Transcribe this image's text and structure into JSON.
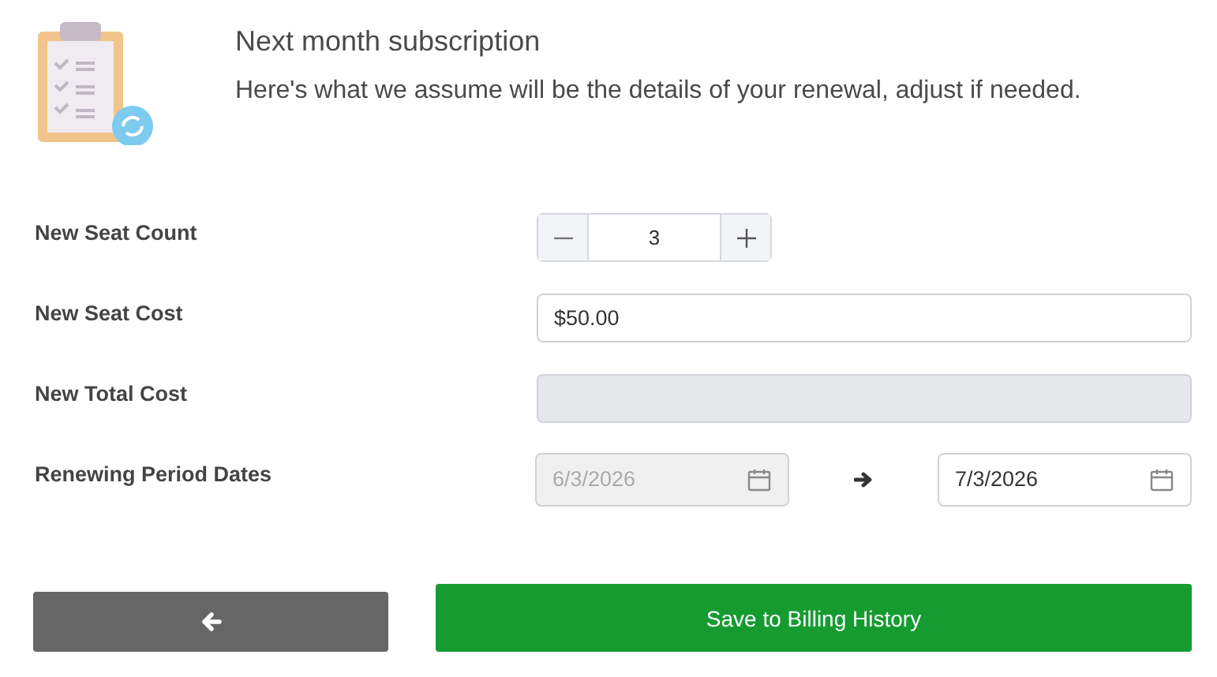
{
  "header": {
    "title": "Next month subscription",
    "description": "Here's what we assume will be the details of your renewal, adjust if needed."
  },
  "rows": [
    {
      "kind": "stepper",
      "label": "New Seat Count",
      "value": "3"
    },
    {
      "kind": "text",
      "label": "New Seat Cost",
      "value": "$50.00",
      "disabled": false
    },
    {
      "kind": "text",
      "label": "New Total Cost",
      "disabled": true
    },
    {
      "kind": "date_range",
      "label": "Renewing Period Dates",
      "start": {
        "value": "6/3/2026",
        "disabled": true
      },
      "end": {
        "value": "7/3/2026",
        "disabled": false
      }
    }
  ],
  "buttons": {
    "save": "Save to Billing History"
  }
}
